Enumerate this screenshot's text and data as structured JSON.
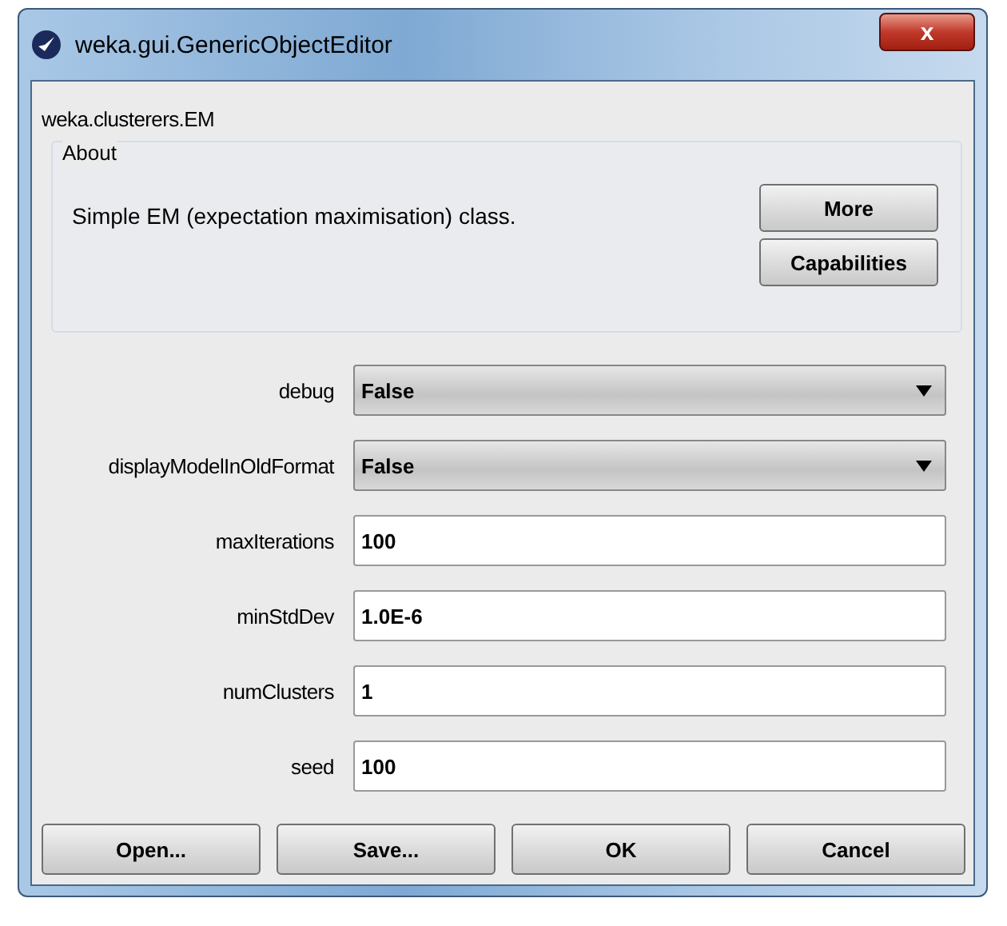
{
  "window": {
    "title": "weka.gui.GenericObjectEditor",
    "close": "x"
  },
  "class_name": "weka.clusterers.EM",
  "about": {
    "legend": "About",
    "text": "Simple EM (expectation maximisation) class.",
    "buttons": [
      "More",
      "Capabilities"
    ]
  },
  "properties": [
    {
      "label": "debug",
      "kind": "dropdown",
      "value": "False"
    },
    {
      "label": "displayModelInOldFormat",
      "kind": "dropdown",
      "value": "False"
    },
    {
      "label": "maxIterations",
      "kind": "text",
      "value": "100"
    },
    {
      "label": "minStdDev",
      "kind": "text",
      "value": "1.0E-6"
    },
    {
      "label": "numClusters",
      "kind": "text",
      "value": "1"
    },
    {
      "label": "seed",
      "kind": "text",
      "value": "100"
    }
  ],
  "buttons": [
    "Open...",
    "Save...",
    "OK",
    "Cancel"
  ]
}
